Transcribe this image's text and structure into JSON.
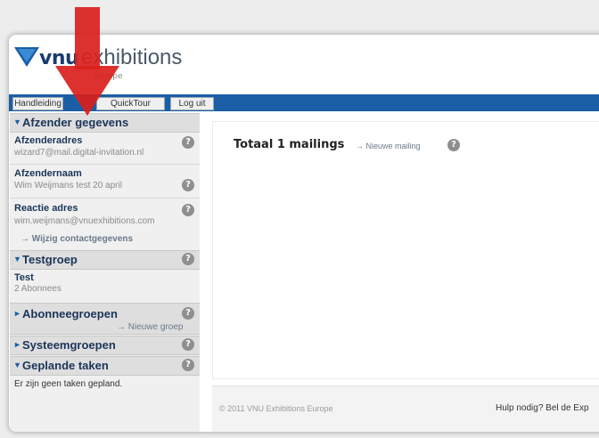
{
  "header": {
    "logo_vnu": "vnu",
    "logo_exhibitions": "exhibitions",
    "logo_sub": "europe"
  },
  "nav": {
    "handleiding": "Handleiding",
    "quicktour": "QuickTour",
    "loguit": "Log uit"
  },
  "sidebar": {
    "afzender": {
      "title": "Afzender gegevens",
      "adres_label": "Afzenderadres",
      "adres_value": "wizard7@mail.digital-invitation.nl",
      "naam_label": "Afzendernaam",
      "naam_value": "Wim Weijmans test 20 april",
      "reactie_label": "Reactie adres",
      "reactie_value": "wim.weijmans@vnuexhibitions.com",
      "wijzig_link": "→ Wijzig contactgegevens"
    },
    "testgroep": {
      "title": "Testgroep",
      "item_label": "Test",
      "item_value": "2 Abonnees"
    },
    "abonnee": {
      "title": "Abonneegroepen",
      "link": "→ Nieuwe groep"
    },
    "systeem": {
      "title": "Systeemgroepen"
    },
    "geplande": {
      "title": "Geplande taken",
      "text": "Er zijn geen taken gepland."
    },
    "help_glyph": "?"
  },
  "main": {
    "title": "Totaal 1 mailings",
    "new_link": "→ Nieuwe mailing",
    "footer_left": "© 2011 VNU Exhibitions Europe",
    "footer_right": "Hulp nodig? Bel de Exp"
  },
  "colors": {
    "nav_blue": "#1a5fa5",
    "sidebar_bg": "#f0f0f0",
    "arrow_red": "#d9201c",
    "title_dark": "#1a3558"
  },
  "icons": [
    "vnu-logo-icon",
    "red-arrow-icon",
    "help-icon",
    "expand-triangle-icon",
    "collapse-triangle-icon"
  ]
}
